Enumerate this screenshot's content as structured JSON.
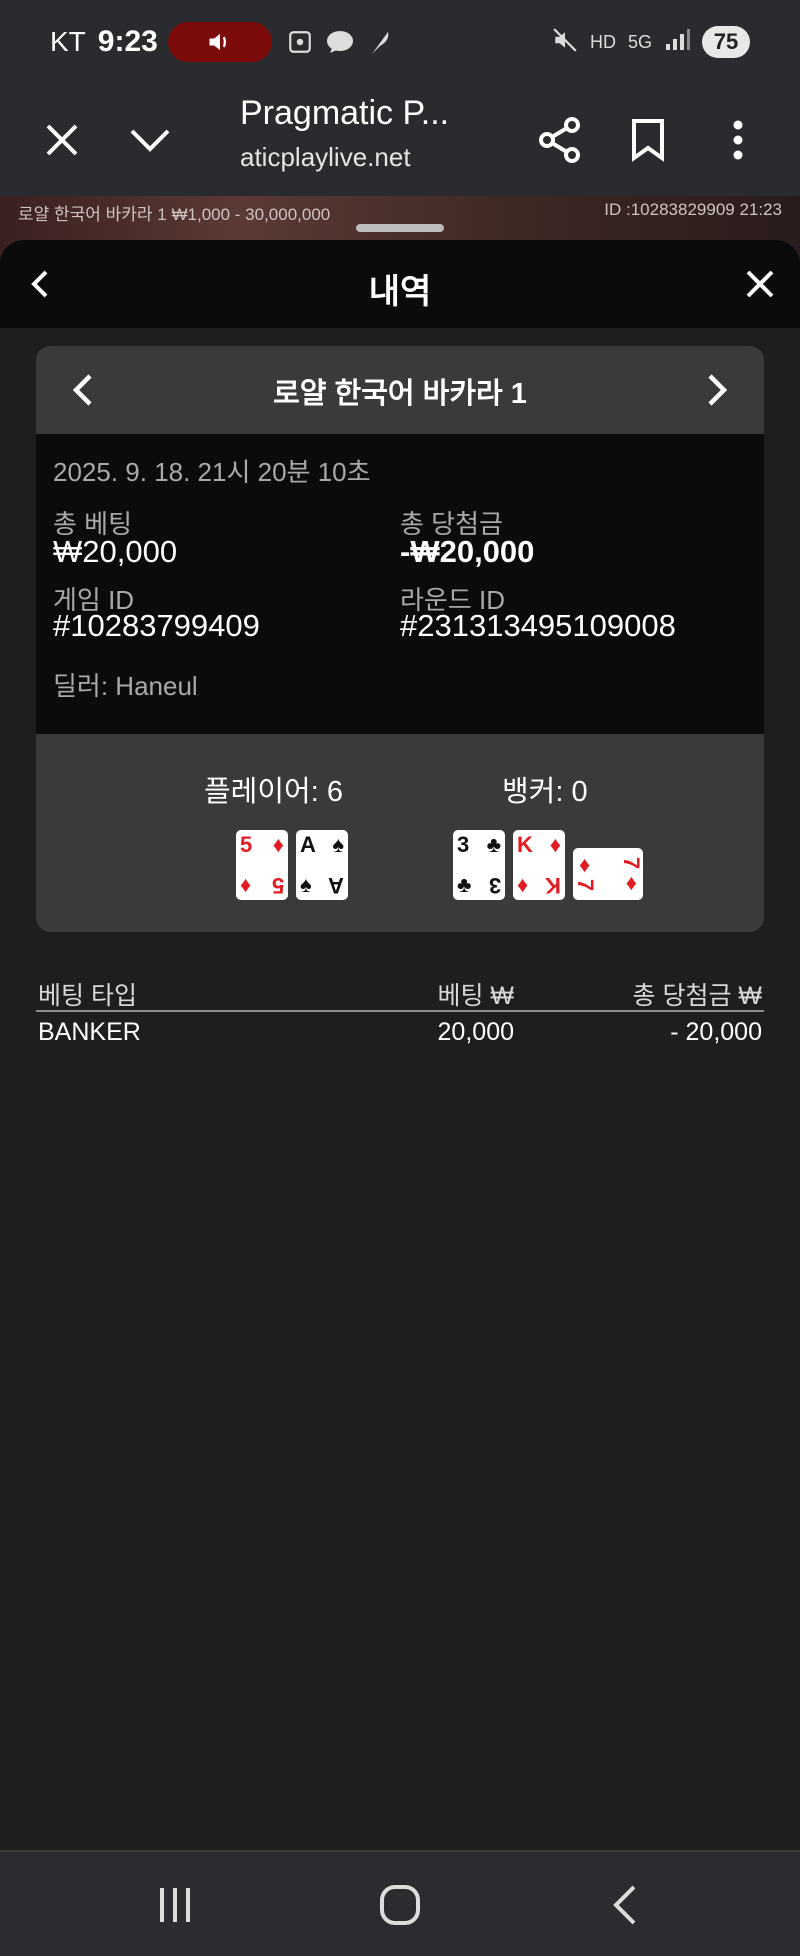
{
  "status_bar": {
    "carrier": "KT",
    "time": "9:23",
    "battery": "75",
    "network": "5G",
    "hd_badge": "HD"
  },
  "browser": {
    "title": "Pragmatic P...",
    "url": "aticplaylive.net"
  },
  "game_strip": {
    "left_text": "로얄 한국어 바카라 1 ₩1,000 - 30,000,000",
    "right_text": "ID :10283829909 21:23"
  },
  "sheet": {
    "title": "내역"
  },
  "round": {
    "table_name": "로얄 한국어 바카라 1",
    "datetime": "2025. 9. 18. 21시 20분 10초",
    "total_bet_label": "총 베팅",
    "total_bet_value": "₩20,000",
    "total_win_label": "총 당첨금",
    "total_win_value": "-₩20,000",
    "game_id_label": "게임 ID",
    "game_id_value": "#10283799409",
    "round_id_label": "라운드 ID",
    "round_id_value": "#231313495109008",
    "dealer": "딜러: Haneul"
  },
  "result": {
    "player_score": "플레이어: 6",
    "banker_score": "뱅커: 0",
    "player_cards": [
      {
        "rank": "5",
        "suit": "♦",
        "color": "#e31b23"
      },
      {
        "rank": "A",
        "suit": "♠",
        "color": "#111111"
      }
    ],
    "banker_cards": [
      {
        "rank": "3",
        "suit": "♣",
        "color": "#111111"
      },
      {
        "rank": "K",
        "suit": "♦",
        "color": "#e31b23"
      },
      {
        "rank": "7",
        "suit": "♦",
        "color": "#e31b23"
      }
    ]
  },
  "bets": {
    "headers": [
      "베팅 타입",
      "베팅 ₩",
      "총 당첨금 ₩"
    ],
    "rows": [
      [
        "BANKER",
        "20,000",
        "- 20,000"
      ]
    ]
  },
  "colors": {
    "sound_pill": "#7c0c0c",
    "header_bg": "#0b0b0b",
    "panel_bg": "#3a3a3a",
    "card_red": "#e31b23"
  }
}
